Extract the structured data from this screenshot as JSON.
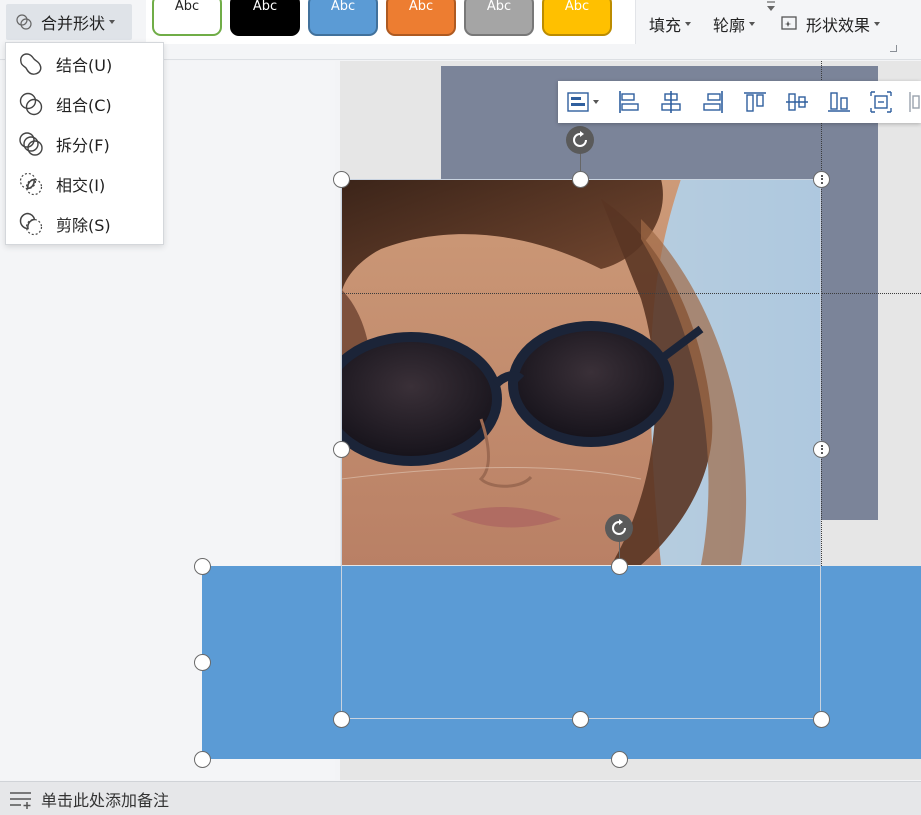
{
  "ribbon": {
    "merge_button_label": "合并形状",
    "style_tiles": [
      {
        "label": "Abc",
        "fill": "#ffffff",
        "border": "#70ad47",
        "text": "#222222"
      },
      {
        "label": "Abc",
        "fill": "#000000",
        "border": "#000000",
        "text": "#ffffff"
      },
      {
        "label": "Abc",
        "fill": "#5b9bd5",
        "border": "#41719c",
        "text": "#ffffff"
      },
      {
        "label": "Abc",
        "fill": "#ed7d31",
        "border": "#ae5a21",
        "text": "#ffffff"
      },
      {
        "label": "Abc",
        "fill": "#a5a5a5",
        "border": "#787878",
        "text": "#ffffff"
      },
      {
        "label": "Abc",
        "fill": "#ffc000",
        "border": "#bc8c00",
        "text": "#ffffff"
      }
    ],
    "fill_label": "填充",
    "outline_label": "轮廓",
    "effects_label": "形状效果"
  },
  "merge_menu": {
    "items": [
      {
        "label": "结合(U)",
        "icon": "union-icon"
      },
      {
        "label": "组合(C)",
        "icon": "combine-icon"
      },
      {
        "label": "拆分(F)",
        "icon": "fragment-icon"
      },
      {
        "label": "相交(I)",
        "icon": "intersect-icon"
      },
      {
        "label": "剪除(S)",
        "icon": "subtract-icon"
      }
    ]
  },
  "align_toolbar": {
    "icons": [
      "smart-align-icon",
      "align-left-icon",
      "align-center-icon",
      "align-right-icon",
      "align-top-icon",
      "align-middle-icon",
      "align-bottom-icon",
      "distribute-horizontal-icon",
      "distribute-vertical-icon"
    ]
  },
  "colors": {
    "blue_shape": "#5b9bd5",
    "gray_shape": "#7b8499",
    "accent": "#4a90e2"
  },
  "notes": {
    "placeholder": "单击此处添加备注"
  }
}
